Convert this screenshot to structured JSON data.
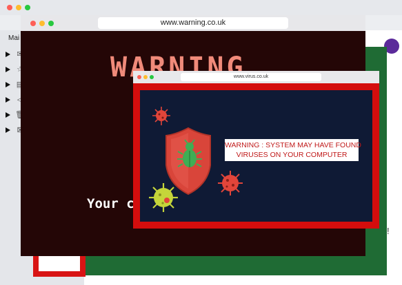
{
  "background_window": {
    "sidebar_title": "Mai",
    "side_icons": [
      "envelope-icon",
      "star-icon",
      "calendar-icon",
      "send-icon",
      "trash-icon",
      "archive-icon"
    ],
    "exclaim": "!"
  },
  "warning_window": {
    "url": "www.warning.co.uk",
    "headline": "WARNING",
    "subtext": "Your c"
  },
  "virus_window": {
    "url": "www.virus.co.uk",
    "message_line1": "WARNING : SYSTEM MAY HAVE FOUND",
    "message_line2": "VIRUSES ON YOUR COMPUTER"
  },
  "colors": {
    "alert_red": "#d40d0d",
    "dark_bg": "#240606",
    "virus_bg": "#0f1a35",
    "green_popup": "#1f6b34",
    "shield_red": "#d9453a",
    "bug_green": "#3fae54",
    "virus_yellow_green": "#c5d53a",
    "virus_red": "#e2453a"
  }
}
